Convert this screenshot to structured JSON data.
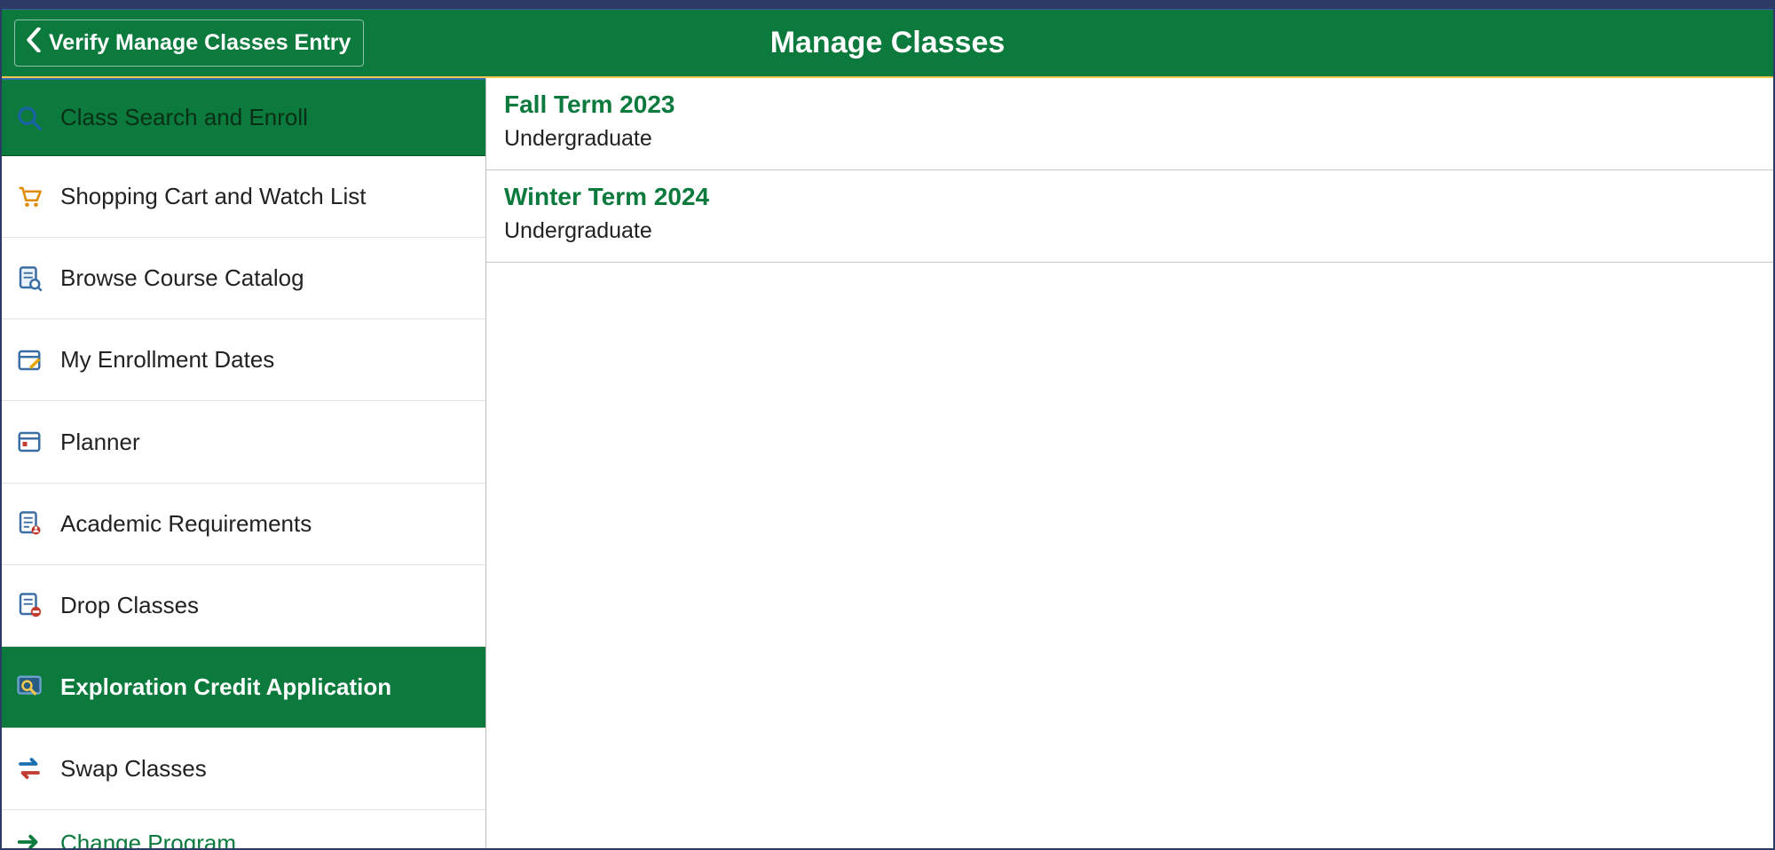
{
  "header": {
    "back_label": "Verify Manage Classes Entry",
    "title": "Manage Classes"
  },
  "sidebar": {
    "items": [
      {
        "label": "Class Search and Enroll",
        "icon": "search-icon",
        "state": "first"
      },
      {
        "label": "Shopping Cart and Watch List",
        "icon": "cart-icon",
        "state": ""
      },
      {
        "label": "Browse Course Catalog",
        "icon": "catalog-icon",
        "state": ""
      },
      {
        "label": "My Enrollment Dates",
        "icon": "calendar-pencil-icon",
        "state": ""
      },
      {
        "label": "Planner",
        "icon": "planner-icon",
        "state": ""
      },
      {
        "label": "Academic Requirements",
        "icon": "checklist-icon",
        "state": ""
      },
      {
        "label": "Drop Classes",
        "icon": "drop-icon",
        "state": ""
      },
      {
        "label": "Exploration Credit Application",
        "icon": "explore-icon",
        "state": "selected"
      },
      {
        "label": "Swap Classes",
        "icon": "swap-icon",
        "state": ""
      },
      {
        "label": "Change Program",
        "icon": "arrow-right-icon",
        "state": "partial"
      }
    ]
  },
  "main": {
    "terms": [
      {
        "title": "Fall Term 2023",
        "level": "Undergraduate"
      },
      {
        "title": "Winter Term 2024",
        "level": "Undergraduate"
      }
    ]
  },
  "colors": {
    "brand_green": "#0b7a3c",
    "accent_yellow": "#f2c94c",
    "frame_blue": "#2c3b66"
  }
}
